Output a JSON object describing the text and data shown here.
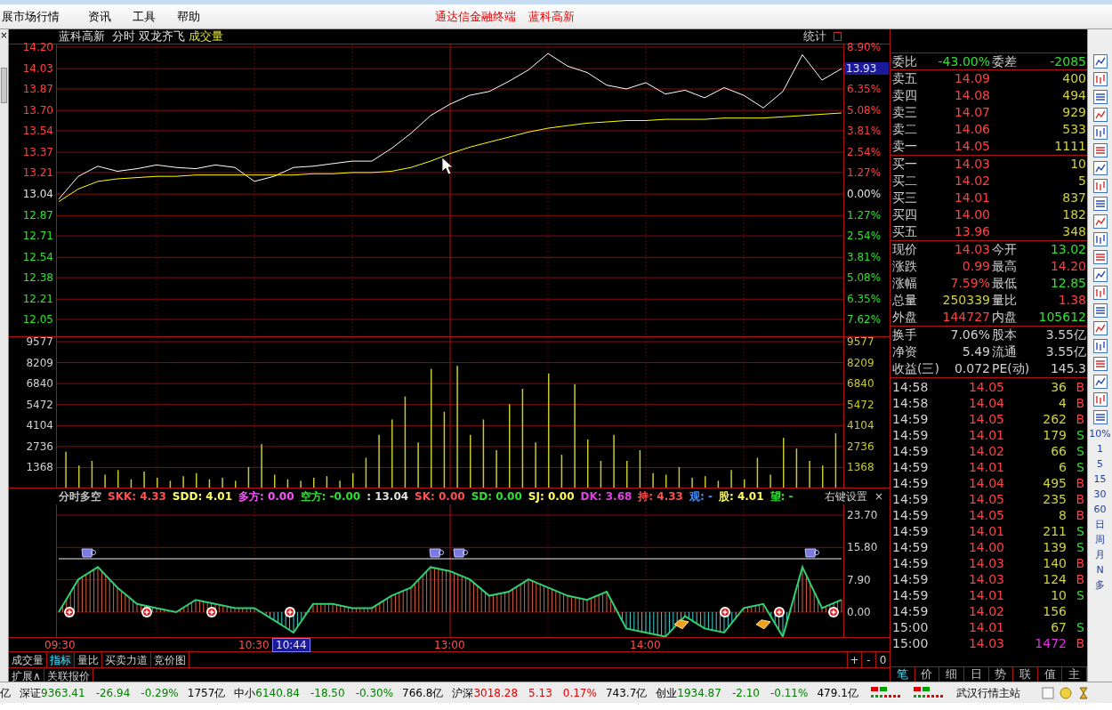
{
  "menu": {
    "items": [
      "展市场行情",
      "资讯",
      "工具",
      "帮助"
    ],
    "title": "通达信金融终端",
    "stock": "蓝科高新"
  },
  "left_strip": {
    "close": "×"
  },
  "chart_header": {
    "stock": "蓝科高新",
    "mode": "分时",
    "formula": "双龙齐飞",
    "indicator": "成交量",
    "stats": "统计"
  },
  "price_panel": {
    "chart_data": {
      "type": "line",
      "grid": true,
      "ylim": [
        12.05,
        14.2
      ],
      "categories": [
        null,
        null,
        null,
        null,
        null,
        null,
        null,
        null,
        null,
        null,
        null,
        null,
        null,
        null,
        null,
        null,
        null,
        null,
        null,
        null,
        null,
        null,
        null,
        null,
        null,
        null,
        null,
        null,
        null,
        null,
        null,
        null,
        null,
        null,
        null,
        null,
        null,
        null,
        null,
        null,
        null
      ],
      "yticks": [
        {
          "value": 14.2,
          "label": "14.20"
        },
        {
          "value": 14.03,
          "label": "14.03"
        },
        {
          "value": 13.87,
          "label": "13.87"
        },
        {
          "value": 13.7,
          "label": "13.70"
        },
        {
          "value": 13.54,
          "label": "13.54"
        },
        {
          "value": 13.37,
          "label": "13.37"
        },
        {
          "value": 13.21,
          "label": "13.21"
        },
        {
          "value": 13.04,
          "label": "13.04"
        },
        {
          "value": 12.87,
          "label": "12.87"
        },
        {
          "value": 12.71,
          "label": "12.71"
        },
        {
          "value": 12.54,
          "label": "12.54"
        },
        {
          "value": 12.38,
          "label": "12.38"
        },
        {
          "value": 12.21,
          "label": "12.21"
        },
        {
          "value": 12.05,
          "label": "12.05"
        }
      ],
      "series": [
        {
          "color": "#ffffff",
          "values": [
            13.0,
            13.18,
            13.26,
            13.22,
            13.24,
            13.27,
            13.25,
            13.24,
            13.27,
            13.25,
            13.14,
            13.18,
            13.25,
            13.26,
            13.28,
            13.3,
            13.3,
            13.4,
            13.52,
            13.66,
            13.75,
            13.82,
            13.85,
            13.93,
            14.02,
            14.15,
            14.05,
            14.0,
            13.9,
            13.87,
            13.92,
            13.83,
            13.86,
            13.8,
            13.88,
            13.82,
            13.72,
            13.85,
            14.14,
            13.94,
            14.03
          ]
        },
        {
          "color": "#ffff00",
          "values": [
            12.98,
            13.08,
            13.14,
            13.16,
            13.17,
            13.18,
            13.18,
            13.19,
            13.19,
            13.19,
            13.19,
            13.19,
            13.19,
            13.2,
            13.2,
            13.21,
            13.21,
            13.22,
            13.25,
            13.3,
            13.36,
            13.41,
            13.45,
            13.49,
            13.53,
            13.56,
            13.58,
            13.6,
            13.61,
            13.62,
            13.62,
            13.63,
            13.63,
            13.63,
            13.64,
            13.64,
            13.64,
            13.65,
            13.66,
            13.67,
            13.68
          ]
        }
      ]
    },
    "right_axis": [
      {
        "kind": "up",
        "label": "8.90%"
      },
      {
        "kind": "tag",
        "label": "13.93"
      },
      {
        "kind": "up",
        "label": "6.35%"
      },
      {
        "kind": "up",
        "label": "5.08%"
      },
      {
        "kind": "up",
        "label": "3.81%"
      },
      {
        "kind": "up",
        "label": "2.54%"
      },
      {
        "kind": "up",
        "label": "1.27%"
      },
      {
        "kind": "flat",
        "label": "0.00%"
      },
      {
        "kind": "down",
        "label": "1.27%"
      },
      {
        "kind": "down",
        "label": "2.54%"
      },
      {
        "kind": "down",
        "label": "3.81%"
      },
      {
        "kind": "down",
        "label": "5.08%"
      },
      {
        "kind": "down",
        "label": "6.35%"
      },
      {
        "kind": "down",
        "label": "7.62%"
      }
    ]
  },
  "volume_panel": {
    "chart_data": {
      "type": "bar",
      "grid": true,
      "ylim": [
        0,
        9577
      ],
      "yticks": [
        {
          "value": 9577,
          "label": "9577"
        },
        {
          "value": 8209,
          "label": "8209"
        },
        {
          "value": 6840,
          "label": "6840"
        },
        {
          "value": 5472,
          "label": "5472"
        },
        {
          "value": 4104,
          "label": "4104"
        },
        {
          "value": 2736,
          "label": "2736"
        },
        {
          "value": 1368,
          "label": "1368"
        }
      ],
      "values": [
        2400,
        1500,
        1800,
        900,
        1200,
        600,
        1100,
        700,
        500,
        800,
        1000,
        600,
        700,
        500,
        1400,
        2900,
        900,
        600,
        500,
        700,
        800,
        500,
        1000,
        2000,
        3500,
        4500,
        6000,
        3000,
        7800,
        5000,
        8000,
        3500,
        4500,
        2500,
        5500,
        6500,
        3000,
        7500,
        2200,
        6800,
        3200,
        1800,
        3500,
        1800,
        2500,
        1000,
        900,
        1400,
        700,
        800,
        500,
        1200,
        600,
        2000,
        900,
        3300,
        2600,
        1800,
        1500,
        3600
      ]
    },
    "right_axis": [
      "9577",
      "8209",
      "6840",
      "5472",
      "4104",
      "2736",
      "1368"
    ]
  },
  "indicator_panel": {
    "header": [
      {
        "text": "分时多空",
        "color": "#c0c0c0"
      },
      {
        "text": "SKK: 4.33",
        "color": "#ff5050"
      },
      {
        "text": "SDD: 4.01",
        "color": "#ffff60"
      },
      {
        "text": "多方: 0.00",
        "color": "#ff50ff"
      },
      {
        "text": "空方: -0.00",
        "color": "#30e030"
      },
      {
        "text": ": 13.04",
        "color": "#e0e0e0"
      },
      {
        "text": "SK: 0.00",
        "color": "#ff5050"
      },
      {
        "text": "SD: 0.00",
        "color": "#30e030"
      },
      {
        "text": "SJ: 0.00",
        "color": "#ffff60"
      },
      {
        "text": "DK: 3.68",
        "color": "#e040e0"
      },
      {
        "text": "持: 4.33",
        "color": "#ff5050"
      },
      {
        "text": "观: -",
        "color": "#4090ff"
      },
      {
        "text": "股: 4.01",
        "color": "#ffff60"
      },
      {
        "text": "望: -",
        "color": "#30e030"
      }
    ],
    "settings": "右键设置",
    "close": "×",
    "chart_data": {
      "type": "line",
      "grid": true,
      "ylim": [
        -6.2,
        23.7
      ],
      "categories": [
        "09:30",
        null,
        null,
        null,
        null,
        null,
        null,
        null,
        null,
        null,
        "10:30",
        null,
        null,
        null,
        null,
        null,
        null,
        null,
        null,
        null,
        "13:00",
        null,
        null,
        null,
        null,
        null,
        null,
        null,
        null,
        null,
        "14:00",
        null,
        null,
        null,
        null,
        null,
        null,
        null,
        null,
        null,
        null
      ],
      "yticks": [
        {
          "value": 23.7,
          "label": "23.70"
        },
        {
          "value": 15.8,
          "label": "15.80"
        },
        {
          "value": 7.9,
          "label": "7.90"
        },
        {
          "value": 0,
          "label": "0.00"
        }
      ],
      "series": [
        {
          "color": "#30d070",
          "values": [
            0,
            8,
            11,
            6,
            2,
            1,
            0,
            3,
            2,
            1,
            1,
            -2,
            -5,
            2,
            2,
            1,
            1,
            4,
            6,
            11,
            10,
            8,
            4,
            5,
            8,
            6,
            4,
            3,
            5,
            -4,
            -5,
            -6,
            -1,
            -4,
            -5,
            1,
            2,
            -6,
            11,
            1,
            3
          ]
        },
        {
          "color": "#f0f0f0",
          "values": [
            13.04,
            13.04,
            13.04,
            13.04,
            13.04,
            13.04,
            13.04,
            13.04,
            13.04,
            13.04,
            13.04,
            13.04,
            13.04,
            13.04,
            13.04,
            13.04,
            13.04,
            13.04,
            13.04,
            13.04,
            13.04,
            13.04,
            13.04,
            13.04,
            13.04,
            13.04,
            13.04,
            13.04,
            13.04,
            13.04,
            13.04,
            13.04,
            13.04,
            13.04,
            13.04,
            13.04,
            13.04,
            13.04,
            13.04,
            13.04,
            13.04
          ]
        }
      ]
    },
    "cursor_time": "10:44"
  },
  "bottom_tabs": [
    {
      "label": "成交量",
      "selected": false
    },
    {
      "label": "指标",
      "selected": true
    },
    {
      "label": "量比",
      "selected": false
    },
    {
      "label": "买卖力道",
      "selected": false
    },
    {
      "label": "竞价图",
      "selected": false
    }
  ],
  "zoom_buttons": [
    "+",
    "-",
    "0"
  ],
  "extra_tabs": [
    "扩展∧",
    "关联报价"
  ],
  "order_book": {
    "ratio": [
      {
        "label": "委比",
        "value": "-43.00%"
      },
      {
        "label": "委差",
        "value": "-2085"
      }
    ],
    "asks": [
      {
        "label": "卖五",
        "price": "14.09",
        "volume": "400"
      },
      {
        "label": "卖四",
        "price": "14.08",
        "volume": "494"
      },
      {
        "label": "卖三",
        "price": "14.07",
        "volume": "929"
      },
      {
        "label": "卖二",
        "price": "14.06",
        "volume": "533"
      },
      {
        "label": "卖一",
        "price": "14.05",
        "volume": "1111"
      }
    ],
    "bids": [
      {
        "label": "买一",
        "price": "14.03",
        "volume": "10"
      },
      {
        "label": "买二",
        "price": "14.02",
        "volume": "5"
      },
      {
        "label": "买三",
        "price": "14.01",
        "volume": "837"
      },
      {
        "label": "买四",
        "price": "14.00",
        "volume": "182"
      },
      {
        "label": "买五",
        "price": "13.96",
        "volume": "348"
      }
    ]
  },
  "quote": [
    {
      "label": "现价",
      "value": "14.03",
      "color": "#ff4040"
    },
    {
      "label": "今开",
      "value": "13.02",
      "color": "#30e030"
    },
    {
      "label": "涨跌",
      "value": "0.99",
      "color": "#ff4040"
    },
    {
      "label": "最高",
      "value": "14.20",
      "color": "#ff4040"
    },
    {
      "label": "涨幅",
      "value": "7.59%",
      "color": "#ff4040"
    },
    {
      "label": "最低",
      "value": "12.85",
      "color": "#30e030"
    },
    {
      "label": "总量",
      "value": "250339",
      "color": "#d0d040"
    },
    {
      "label": "量比",
      "value": "1.38",
      "color": "#ff4040"
    },
    {
      "label": "外盘",
      "value": "144727",
      "color": "#ff4040"
    },
    {
      "label": "内盘",
      "value": "105612",
      "color": "#30e030"
    }
  ],
  "fundamentals": [
    {
      "label": "换手",
      "value": "7.06%"
    },
    {
      "label": "股本",
      "value": "3.55亿"
    },
    {
      "label": "净资",
      "value": "5.49"
    },
    {
      "label": "流通",
      "value": "3.55亿"
    },
    {
      "label": "收益(三)",
      "value": "0.072"
    },
    {
      "label": "PE(动)",
      "value": "145.3"
    }
  ],
  "trades": [
    {
      "time": "14:58",
      "price": "14.05",
      "volume": "36",
      "side": "B",
      "kind": "buy",
      "large": false
    },
    {
      "time": "14:58",
      "price": "14.04",
      "volume": "4",
      "side": "B",
      "kind": "buy",
      "large": false
    },
    {
      "time": "14:59",
      "price": "14.05",
      "volume": "262",
      "side": "B",
      "kind": "buy",
      "large": false
    },
    {
      "time": "14:59",
      "price": "14.01",
      "volume": "179",
      "side": "S",
      "kind": "sell",
      "large": false
    },
    {
      "time": "14:59",
      "price": "14.02",
      "volume": "66",
      "side": "S",
      "kind": "sell",
      "large": false
    },
    {
      "time": "14:59",
      "price": "14.01",
      "volume": "6",
      "side": "S",
      "kind": "sell",
      "large": false
    },
    {
      "time": "14:59",
      "price": "14.04",
      "volume": "495",
      "side": "B",
      "kind": "buy",
      "large": false
    },
    {
      "time": "14:59",
      "price": "14.05",
      "volume": "235",
      "side": "B",
      "kind": "buy",
      "large": false
    },
    {
      "time": "14:59",
      "price": "14.05",
      "volume": "8",
      "side": "B",
      "kind": "buy",
      "large": false
    },
    {
      "time": "14:59",
      "price": "14.01",
      "volume": "211",
      "side": "S",
      "kind": "sell",
      "large": false
    },
    {
      "time": "14:59",
      "price": "14.00",
      "volume": "139",
      "side": "S",
      "kind": "sell",
      "large": false
    },
    {
      "time": "14:59",
      "price": "14.03",
      "volume": "140",
      "side": "B",
      "kind": "buy",
      "large": false
    },
    {
      "time": "14:59",
      "price": "14.03",
      "volume": "124",
      "side": "B",
      "kind": "buy",
      "large": false
    },
    {
      "time": "14:59",
      "price": "14.01",
      "volume": "10",
      "side": "S",
      "kind": "sell",
      "large": false
    },
    {
      "time": "14:59",
      "price": "14.02",
      "volume": "156",
      "kind": "none",
      "large": false
    },
    {
      "time": "15:00",
      "price": "14.01",
      "volume": "67",
      "side": "S",
      "kind": "sell",
      "large": false
    },
    {
      "time": "15:00",
      "price": "14.03",
      "volume": "1472",
      "side": "B",
      "kind": "buy",
      "large": true
    }
  ],
  "panel_tabs": [
    {
      "label": "笔",
      "selected": true
    },
    {
      "label": "价",
      "selected": false
    },
    {
      "label": "细",
      "selected": false
    },
    {
      "label": "日",
      "selected": false
    },
    {
      "label": "势",
      "selected": false
    },
    {
      "label": "联",
      "selected": false
    },
    {
      "label": "值",
      "selected": false
    },
    {
      "label": "主",
      "selected": false
    }
  ],
  "toolbar_labels": [
    "10%",
    "1",
    "5",
    "15",
    "30",
    "60",
    "日",
    "周",
    "月",
    "N",
    "多"
  ],
  "status_bar": {
    "prefix": "亿",
    "indices": [
      {
        "name": "深证",
        "value": "9363.41",
        "change": "-26.94",
        "percent": "-0.29%",
        "amount": "1757亿",
        "up": false
      },
      {
        "name": "中小",
        "value": "6140.84",
        "change": "-18.50",
        "percent": "-0.30%",
        "amount": "766.8亿",
        "up": false
      },
      {
        "name": "沪深",
        "value": "3018.28",
        "change": "5.13",
        "percent": "0.17%",
        "amount": "743.7亿",
        "up": true
      },
      {
        "name": "创业",
        "value": "1934.87",
        "change": "-2.10",
        "percent": "-0.11%",
        "amount": "479.1亿",
        "up": false
      }
    ],
    "server": "武汉行情主站"
  }
}
